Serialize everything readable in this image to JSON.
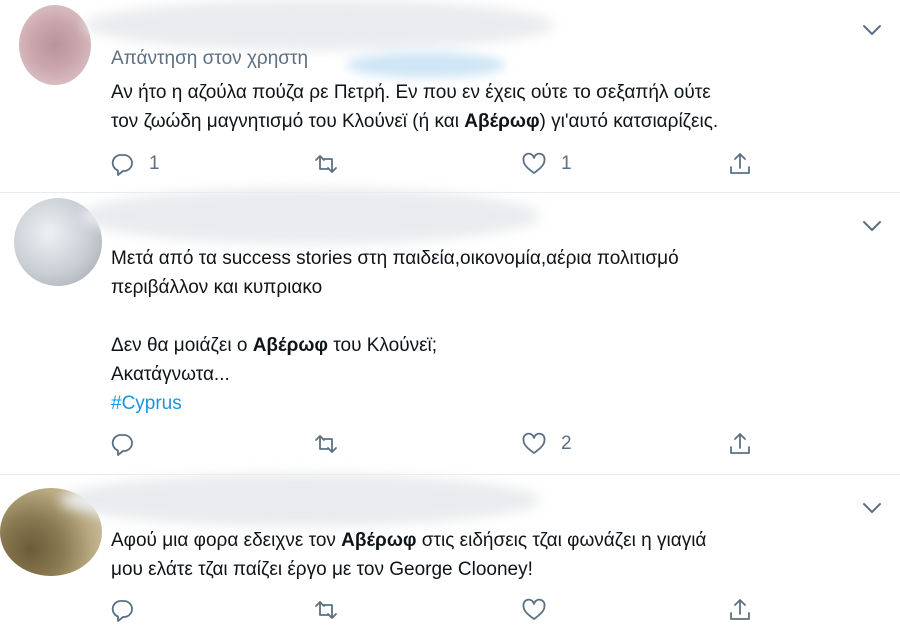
{
  "tweets": [
    {
      "reply_to_label": "Απάντηση στον χρηστη",
      "lines": [
        [
          {
            "text": "Αν ήτο η αζούλα πούζα ρε Πετρή. Εν που εν έχεις ούτε  το σεξαπήλ ούτε"
          }
        ],
        [
          {
            "text": "τον ζωώδη μαγνητισμό του Κλούνεϊ (ή και "
          },
          {
            "text": "Αβέρωφ",
            "bold": true
          },
          {
            "text": ") γι'αυτό κατσιαρίζεις."
          }
        ]
      ],
      "actions": {
        "reply_count": "1",
        "retweet_count": "",
        "like_count": "1"
      }
    },
    {
      "reply_to_label": "",
      "lines": [
        [
          {
            "text": "Μετά από τα success stories στη παιδεία,οικονομία,αέρια  πολιτισμό"
          }
        ],
        [
          {
            "text": "περιβάλλον και κυπριακο"
          }
        ],
        [
          {
            "text": ""
          }
        ],
        [
          {
            "text": "Δεν θα μοιάζει ο "
          },
          {
            "text": "Αβέρωφ",
            "bold": true
          },
          {
            "text": " του Κλούνεϊ;"
          }
        ],
        [
          {
            "text": "Ακατάγνωτα..."
          }
        ],
        [
          {
            "text": "#Cyprus",
            "hashtag": true
          }
        ]
      ],
      "actions": {
        "reply_count": "",
        "retweet_count": "",
        "like_count": "2"
      }
    },
    {
      "reply_to_label": "",
      "lines": [
        [
          {
            "text": "Αφού μια φορα εδειχνε τον "
          },
          {
            "text": "Αβέρωφ",
            "bold": true
          },
          {
            "text": " στις ειδήσεις τζαι φωνάζει η γιαγιά"
          }
        ],
        [
          {
            "text": "μου ελάτε τζαι παίζει έργο με τον George Clooney!"
          }
        ]
      ],
      "actions": {
        "reply_count": "",
        "retweet_count": "",
        "like_count": ""
      }
    }
  ],
  "icons": {
    "reply": "reply-icon",
    "retweet": "retweet-icon",
    "like": "heart-icon",
    "share": "share-icon",
    "more": "chevron-down-icon"
  },
  "colors": {
    "text": "#0f1419",
    "secondary": "#5b7083",
    "hashtag": "#1b95e0",
    "divider": "#e6ecf0"
  }
}
